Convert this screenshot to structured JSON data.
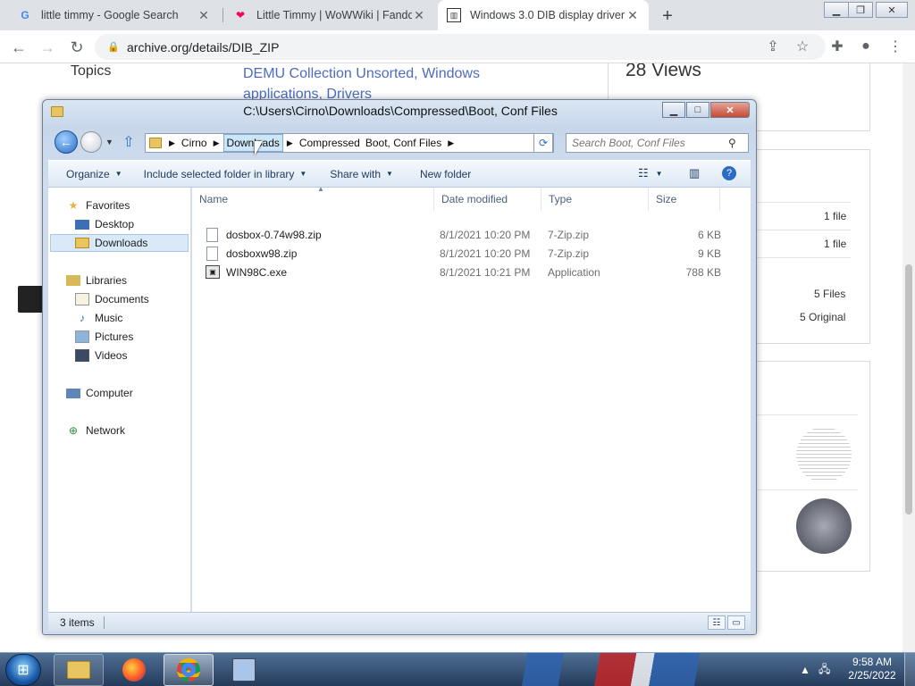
{
  "browser": {
    "tabs": [
      {
        "title": "little timmy - Google Search",
        "icon": "google-icon",
        "active": false
      },
      {
        "title": "Little Timmy | WoWWiki | Fandom",
        "icon": "fandom-icon",
        "active": false
      },
      {
        "title": "Windows 3.0 DIB display driver",
        "icon": "archive-icon",
        "active": true
      }
    ],
    "url": "archive.org/details/DIB_ZIP"
  },
  "page": {
    "topics_label": "Topics",
    "topics_value": "DEMU Collection Unsorted, Windows applications, Drivers",
    "views": "28 Views",
    "rows": [
      {
        "value": "1 file"
      },
      {
        "value": "1 file"
      },
      {
        "value": "5 Files"
      },
      {
        "value": "5 Original"
      }
    ]
  },
  "explorer": {
    "title": "C:\\Users\\Cirno\\Downloads\\Compressed\\Boot, Conf Files",
    "breadcrumb": [
      "Cirno",
      "Downloads",
      "Compressed",
      "Boot, Conf Files"
    ],
    "search_placeholder": "Search Boot, Conf Files",
    "commands": {
      "organize": "Organize",
      "include": "Include selected folder in library",
      "share": "Share with",
      "new_folder": "New folder"
    },
    "nav": {
      "favorites": "Favorites",
      "desktop": "Desktop",
      "downloads": "Downloads",
      "libraries": "Libraries",
      "documents": "Documents",
      "music": "Music",
      "pictures": "Pictures",
      "videos": "Videos",
      "computer": "Computer",
      "network": "Network"
    },
    "columns": {
      "name": "Name",
      "date": "Date modified",
      "type": "Type",
      "size": "Size"
    },
    "files": [
      {
        "name": "dosbox-0.74w98.zip",
        "date": "8/1/2021 10:20 PM",
        "type": "7-Zip.zip",
        "size": "6 KB"
      },
      {
        "name": "dosboxw98.zip",
        "date": "8/1/2021 10:20 PM",
        "type": "7-Zip.zip",
        "size": "9 KB"
      },
      {
        "name": "WIN98C.exe",
        "date": "8/1/2021 10:21 PM",
        "type": "Application",
        "size": "788 KB"
      }
    ],
    "status": "3 items"
  },
  "taskbar": {
    "time": "9:58 AM",
    "date": "2/25/2022"
  },
  "colors": {
    "accent": "#2b6cc4",
    "link": "#4b6cc1",
    "selection": "#d9e9f7"
  }
}
